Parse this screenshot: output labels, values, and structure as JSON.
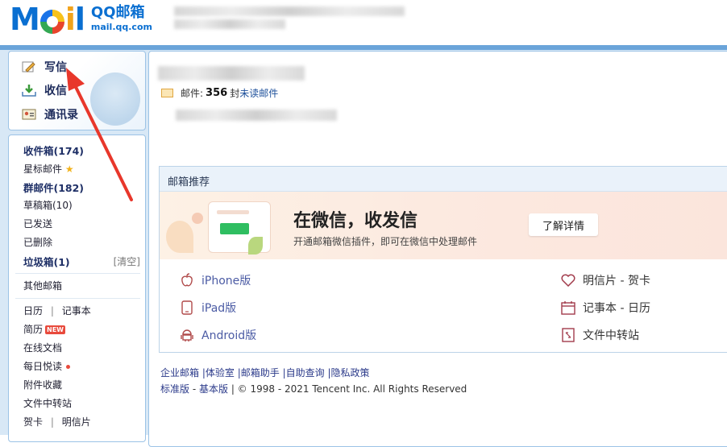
{
  "logo": {
    "word_m": "M",
    "word_i": "i",
    "word_l": "l",
    "product": "QQ邮箱",
    "domain": "mail.qq.com"
  },
  "write_panel": {
    "items": [
      {
        "label": "写信",
        "icon": "pencil-icon"
      },
      {
        "label": "收信",
        "icon": "inbox-download-icon"
      },
      {
        "label": "通讯录",
        "icon": "contacts-icon"
      }
    ]
  },
  "folders": {
    "inbox": "收件箱(174)",
    "starred": "星标邮件",
    "group": "群邮件(182)",
    "drafts": "草稿箱(10)",
    "sent": "已发送",
    "deleted": "已删除",
    "spam": "垃圾箱(1)",
    "spam_clean": "[清空]",
    "other": "其他邮箱",
    "calendar": "日历",
    "calendar_sep": "|",
    "notes": "记事本",
    "resume": "简历",
    "resume_badge": "NEW",
    "docs": "在线文档",
    "daily": "每日悦读",
    "attachments": "附件收藏",
    "transfer": "文件中转站",
    "card": "贺卡",
    "card_sep": "|",
    "postcard": "明信片"
  },
  "summary": {
    "prefix": "邮件:",
    "count": "356",
    "unit": "封",
    "unread_label": "未读邮件"
  },
  "recommend": {
    "header": "邮箱推荐",
    "banner_title": "在微信，收发信",
    "banner_sub": "开通邮箱微信插件，即可在微信中处理邮件",
    "banner_button": "了解详情",
    "left_links": [
      "iPhone版",
      "iPad版",
      "Android版"
    ],
    "right_links": [
      "明信片 - 贺卡",
      "记事本 - 日历",
      "文件中转站"
    ]
  },
  "footer": {
    "links": [
      "企业邮箱",
      "|体验室",
      "|邮箱助手",
      "|自助查询",
      "|隐私政策"
    ],
    "standard": "标准版",
    "dash": " - ",
    "basic": "基本版",
    "copyright": " | © 1998 - 2021 Tencent Inc. All Rights Reserved"
  },
  "colors": {
    "brand_blue": "#0a6fd1",
    "frame_blue": "#d8e8f6",
    "arrow_red": "#e8372b",
    "badge_red": "#e84a3c"
  }
}
